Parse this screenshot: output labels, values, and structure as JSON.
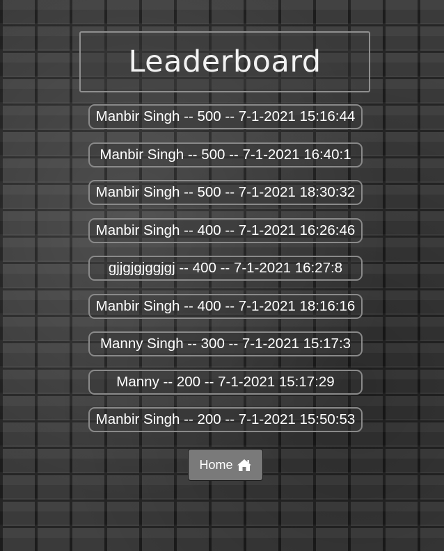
{
  "page": {
    "title": "Leaderboard"
  },
  "leaderboard": {
    "entries": [
      {
        "text": "Manbir Singh -- 500 -- 7-1-2021 15:16:44"
      },
      {
        "text": "Manbir Singh -- 500 -- 7-1-2021 16:40:1"
      },
      {
        "text": "Manbir Singh -- 500 -- 7-1-2021 18:30:32"
      },
      {
        "text": "Manbir Singh -- 400 -- 7-1-2021 16:26:46"
      },
      {
        "text": "gjjgjgjggjgj -- 400 -- 7-1-2021 16:27:8"
      },
      {
        "text": "Manbir Singh -- 400 -- 7-1-2021 18:16:16"
      },
      {
        "text": "Manny Singh -- 300 -- 7-1-2021 15:17:3"
      },
      {
        "text": "Manny -- 200 -- 7-1-2021 15:17:29"
      },
      {
        "text": "Manbir Singh -- 200 -- 7-1-2021 15:50:53"
      }
    ]
  },
  "nav": {
    "home_label": "Home",
    "home_icon": "home-icon"
  },
  "colors": {
    "background": "#3a3a3a",
    "border": "#8a8a8a",
    "button": "#7a7a7a",
    "text": "#ffffff"
  }
}
